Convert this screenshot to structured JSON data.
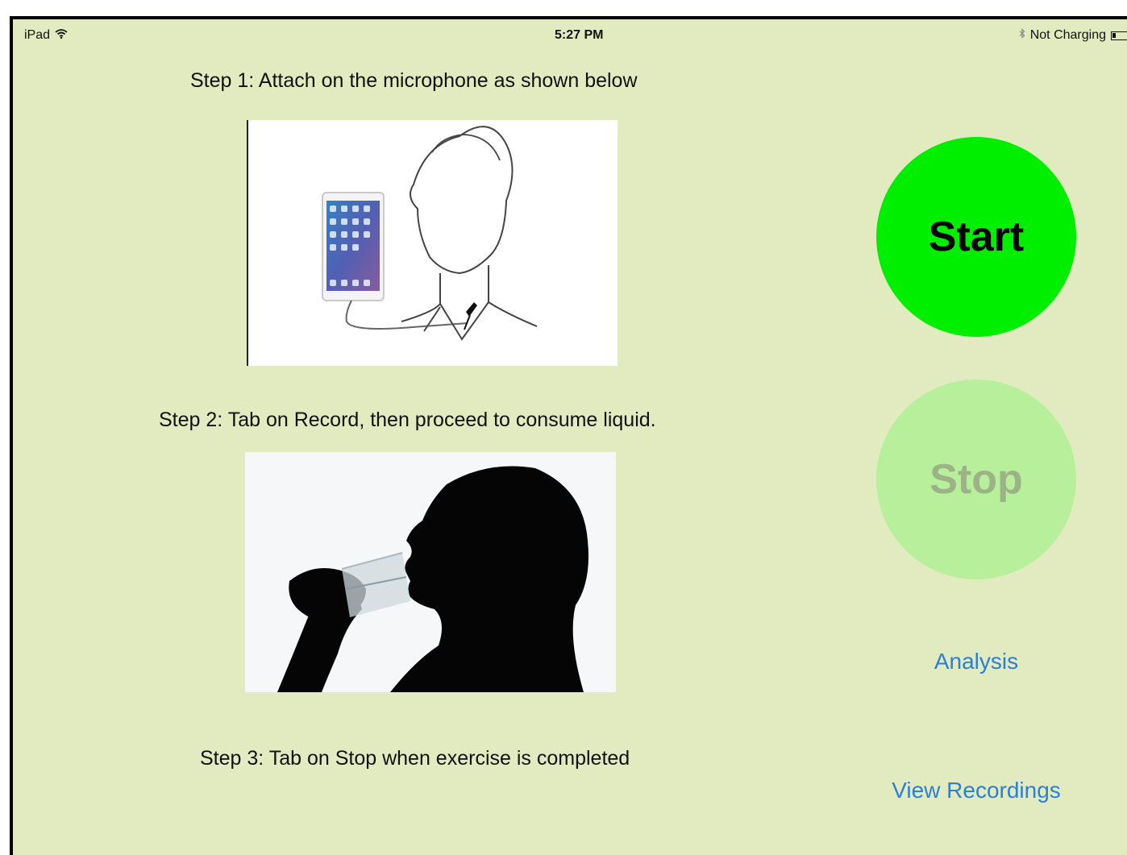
{
  "status_bar": {
    "device": "iPad",
    "time": "5:27 PM",
    "battery_status": "Not Charging",
    "icons": [
      "wifi-icon",
      "bluetooth-icon",
      "battery-icon"
    ]
  },
  "steps": {
    "step1": "Step 1: Attach on the microphone as shown below",
    "step2": "Step 2: Tab on Record, then proceed to consume liquid.",
    "step3": "Step 3: Tab on Stop when exercise is completed"
  },
  "buttons": {
    "start": "Start",
    "stop": "Stop",
    "start_color": "#00ee00",
    "stop_color": "#b7ef9b"
  },
  "links": {
    "analysis": "Analysis",
    "view_recordings": "View Recordings"
  },
  "colors": {
    "background": "#e2ebbf",
    "link": "#2c7fd6"
  }
}
